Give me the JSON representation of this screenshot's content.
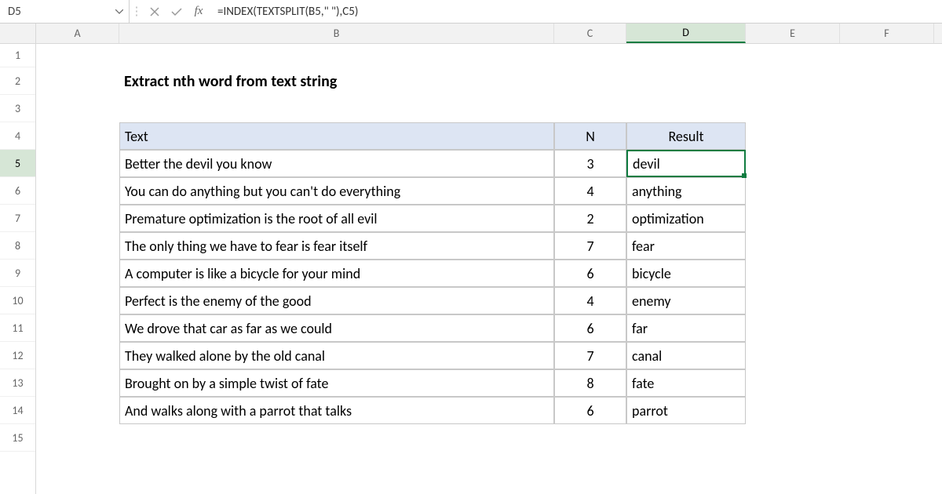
{
  "name_box": "D5",
  "formula": "=INDEX(TEXTSPLIT(B5,\" \"),C5)",
  "columns": [
    "A",
    "B",
    "C",
    "D",
    "E",
    "F"
  ],
  "row_numbers": [
    "1",
    "2",
    "3",
    "4",
    "5",
    "6",
    "7",
    "8",
    "9",
    "10",
    "11",
    "12",
    "13",
    "14",
    "15"
  ],
  "title": "Extract nth word from text string",
  "headers": {
    "text": "Text",
    "n": "N",
    "result": "Result"
  },
  "rows": [
    {
      "text": "Better the devil you know",
      "n": "3",
      "result": "devil"
    },
    {
      "text": "You can do anything but you can't do everything",
      "n": "4",
      "result": "anything"
    },
    {
      "text": "Premature optimization is the root of all evil",
      "n": "2",
      "result": "optimization"
    },
    {
      "text": "The only thing we have to fear is fear itself",
      "n": "7",
      "result": "fear"
    },
    {
      "text": "A computer is like a bicycle for your mind",
      "n": "6",
      "result": "bicycle"
    },
    {
      "text": "Perfect is the enemy of the good",
      "n": "4",
      "result": "enemy"
    },
    {
      "text": "We drove that car as far as we could",
      "n": "6",
      "result": "far"
    },
    {
      "text": "They walked alone by the old canal",
      "n": "7",
      "result": "canal"
    },
    {
      "text": "Brought on by a simple twist of fate",
      "n": "8",
      "result": "fate"
    },
    {
      "text": "And walks along with a parrot that talks",
      "n": "6",
      "result": "parrot"
    }
  ],
  "active_cell": "D5",
  "selected_row": "5",
  "selected_col": "D"
}
